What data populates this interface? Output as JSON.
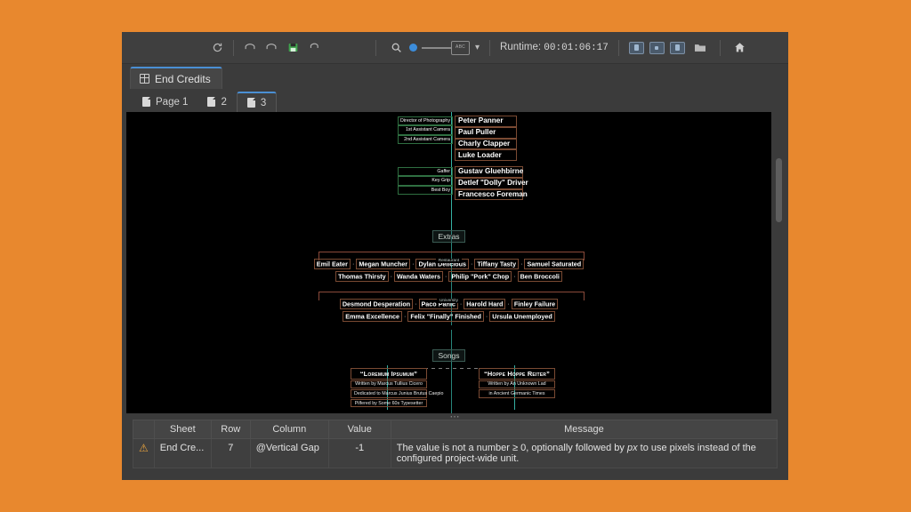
{
  "window": {
    "title": "End Credits"
  },
  "toolbar": {
    "refresh_label": "refresh",
    "undo_label": "undo",
    "redo_label": "redo",
    "save_label": "save",
    "revert_label": "revert",
    "search_label": "search",
    "zoom_value": "100%",
    "zoom_box_label": "ABC",
    "dropdown_label": "open dropdown",
    "runtime_label": "Runtime:",
    "runtime_value": "00:01:06:17",
    "pane_left_label": "toggle left pane",
    "pane_center_label": "toggle center pane",
    "pane_right_label": "toggle right pane",
    "folder_label": "open project folder",
    "home_label": "home"
  },
  "sheet_tabs": [
    {
      "label": "End Credits",
      "active": true
    }
  ],
  "page_tabs": [
    {
      "label": "Page 1",
      "active": false
    },
    {
      "label": "2",
      "active": false
    },
    {
      "label": "3",
      "active": true
    }
  ],
  "credits": {
    "crew_block_1": {
      "roles": [
        "Director of Photography",
        "1st Assistant Camera",
        "2nd Assistant Camera"
      ],
      "names": [
        "Peter Panner",
        "Paul Puller",
        "Charly Clapper",
        "Luke Loader"
      ]
    },
    "crew_block_2": {
      "roles": [
        "Gaffer",
        "Key Grip",
        "Best Boy"
      ],
      "names": [
        "Gustav Gluehbirne",
        "Detlef \"Dolly\" Driver",
        "Francesco Foreman"
      ]
    },
    "extras": {
      "heading": "Extras",
      "groups": [
        {
          "subheading": "Restaurant",
          "rows": [
            [
              "Emil Eater",
              "Megan Muncher",
              "Dylan Delicious",
              "Tiffany Tasty",
              "Samuel Saturated"
            ],
            [
              "Thomas Thirsty",
              "Wanda Waters",
              "Philip \"Pork\" Chop",
              "Ben Broccoli"
            ]
          ]
        },
        {
          "subheading": "University",
          "rows": [
            [
              "Desmond Desperation",
              "Paco Panic",
              "Harold Hard",
              "Finley Failure"
            ],
            [
              "Emma Excellence",
              "Felix \"Finally\" Finished",
              "Ursula Unemployed"
            ]
          ]
        }
      ]
    },
    "songs": {
      "heading": "Songs",
      "items": [
        {
          "title": "“Loremum Ipsumum”",
          "lines": [
            "Written by Marcus Tullius Cicero",
            "Dedicated to Marcus Junius Brutus Caepio",
            "Pilfered by Some 60s Typesetter"
          ]
        },
        {
          "title": "“Hoppe Hoppe Reiter”",
          "lines": [
            "Written by An Unknown Lad",
            "in Ancient Germanic Times"
          ]
        }
      ]
    }
  },
  "problems": {
    "columns": [
      "",
      "Sheet",
      "Row",
      "Column",
      "Value",
      "Message"
    ],
    "rows": [
      {
        "icon": "warning-icon",
        "sheet": "End Cre...",
        "row": "7",
        "column": "@Vertical Gap",
        "value": "-1",
        "message_pre": "The value is not a number ≥ 0, optionally followed by ",
        "message_em": "px",
        "message_post": " to use pixels instead of the configured project-wide unit."
      }
    ]
  },
  "colors": {
    "background": "#e8882e",
    "window": "#3b3b3b",
    "accent": "#4a8fd4",
    "save_green": "#3fa34d",
    "warning": "#e8a33d",
    "guide_teal": "#3ecfc0",
    "group_green": "#2f6f41",
    "name_brown": "#7a4a33"
  }
}
